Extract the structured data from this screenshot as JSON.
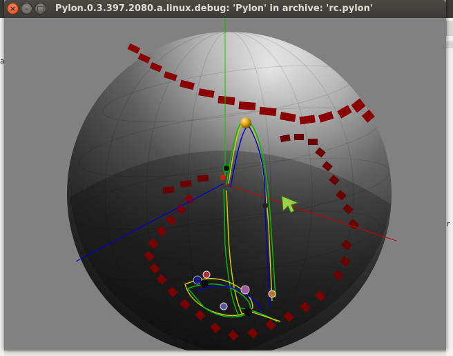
{
  "window": {
    "title": "Pylon.0.3.397.2080.a.linux.debug: 'Pylon' in archive: 'rc.pylon'",
    "controls": {
      "close": "×",
      "minimize": "–",
      "maximize": "□"
    }
  },
  "background_app": {
    "edge_text_right": "r",
    "edge_text_left": "a"
  },
  "scene": {
    "background_color": "#818181",
    "axis_colors": {
      "x": "#cc0000",
      "y": "#00cc00",
      "z": "#0000cc"
    },
    "icons": [
      "mouse-cursor-icon"
    ]
  }
}
